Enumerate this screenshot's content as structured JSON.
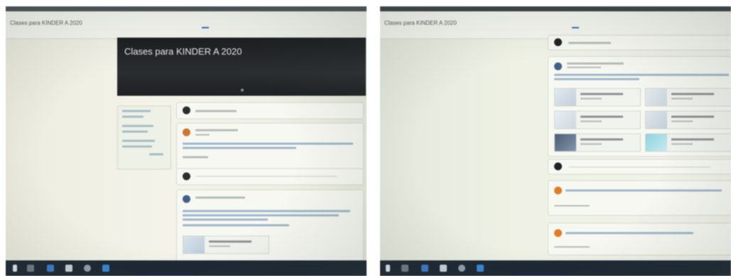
{
  "left_photo": {
    "app_title": "Clases para KINDER A 2020",
    "banner_title": "Clases para KINDER A 2020"
  },
  "right_photo": {
    "app_title": "Clases para KINDER A 2020"
  },
  "colors": {
    "banner": "#1f2124",
    "accent_tab": "#2f6bb4",
    "taskbar": "#1c2733",
    "avatar_orange": "#e07b2a",
    "avatar_dark": "#2a2c2f"
  },
  "icons": [
    "search-icon",
    "folder-icon",
    "browser-icon",
    "windows-icon",
    "avatar-icon",
    "attachment-thumbnail"
  ]
}
